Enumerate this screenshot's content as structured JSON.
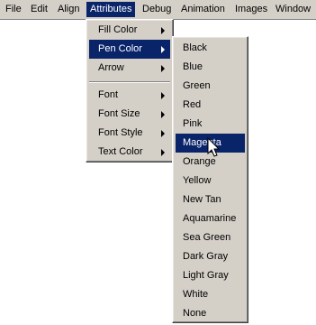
{
  "menubar": {
    "items": [
      "File",
      "Edit",
      "Align",
      "Attributes",
      "Debug",
      "Animation",
      "Images",
      "Window"
    ],
    "active": "Attributes"
  },
  "attributes_menu": {
    "group1": [
      "Fill Color",
      "Pen Color",
      "Arrow"
    ],
    "group2": [
      "Font",
      "Font Size",
      "Font Style",
      "Text Color"
    ],
    "active": "Pen Color"
  },
  "pen_color_menu": {
    "items": [
      "Black",
      "Blue",
      "Green",
      "Red",
      "Pink",
      "Magenta",
      "Orange",
      "Yellow",
      "New Tan",
      "Aquamarine",
      "Sea Green",
      "Dark Gray",
      "Light Gray",
      "White",
      "None"
    ],
    "highlighted": "Magenta"
  },
  "colors": {
    "menu_face": "#d4d0c8",
    "highlight": "#0a246a",
    "highlight_text": "#ffffff"
  }
}
